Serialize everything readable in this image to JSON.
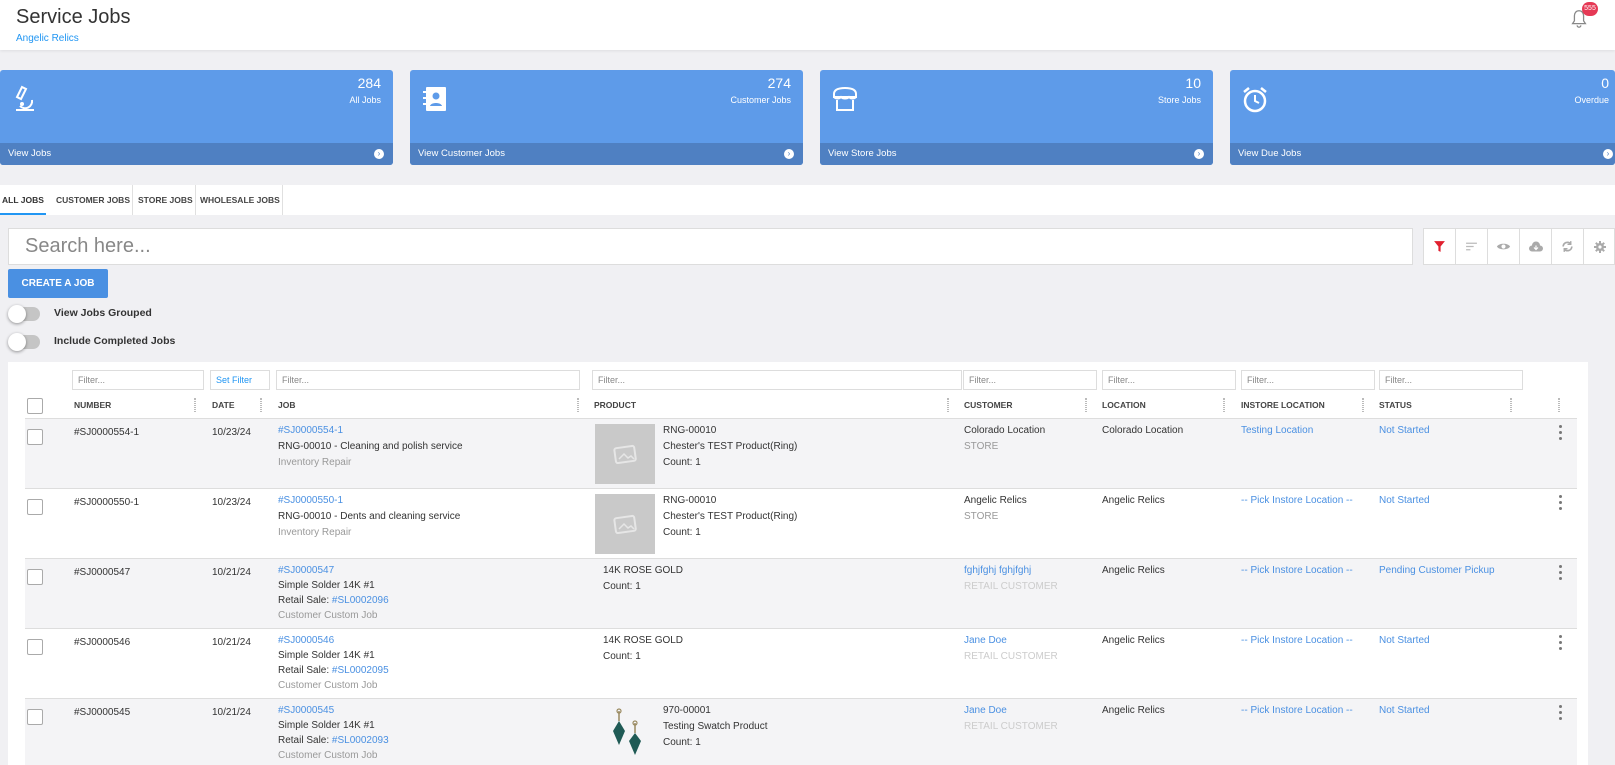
{
  "header": {
    "title": "Service Jobs",
    "subtitle": "Angelic Relics",
    "notification_count": "555"
  },
  "cards": [
    {
      "count": "284",
      "label": "All Jobs",
      "link": "View Jobs",
      "icon": "microscope-icon"
    },
    {
      "count": "274",
      "label": "Customer Jobs",
      "link": "View Customer Jobs",
      "icon": "contact-book-icon"
    },
    {
      "count": "10",
      "label": "Store Jobs",
      "link": "View Store Jobs",
      "icon": "store-icon"
    },
    {
      "count": "0",
      "label": "Overdue",
      "link": "View Due Jobs",
      "icon": "alarm-clock-icon"
    }
  ],
  "tabs": [
    "ALL JOBS",
    "CUSTOMER JOBS",
    "STORE JOBS",
    "WHOLESALE JOBS"
  ],
  "search": {
    "placeholder": "Search here..."
  },
  "create_button": "CREATE A JOB",
  "toggles": {
    "grouped": "View Jobs Grouped",
    "completed": "Include Completed Jobs"
  },
  "filters": {
    "number": "Filter...",
    "date": "Set Filter",
    "job": "Filter...",
    "product": "Filter...",
    "customer": "Filter...",
    "location": "Filter...",
    "instore": "Filter...",
    "status": "Filter..."
  },
  "columns": [
    "NUMBER",
    "DATE",
    "JOB",
    "PRODUCT",
    "CUSTOMER",
    "LOCATION",
    "INSTORE LOCATION",
    "STATUS"
  ],
  "rows": [
    {
      "number": "#SJ0000554-1",
      "date": "10/23/24",
      "job_link": "#SJ0000554-1",
      "job_desc": "RNG-00010 - Cleaning and polish service",
      "job_type": "Inventory Repair",
      "product_sku": "RNG-00010",
      "product_name": "Chester's TEST Product(Ring)",
      "product_count": "Count: 1",
      "customer": "Colorado Location",
      "customer_type": "STORE",
      "location": "Colorado Location",
      "instore": "Testing Location",
      "status": "Not Started"
    },
    {
      "number": "#SJ0000550-1",
      "date": "10/23/24",
      "job_link": "#SJ0000550-1",
      "job_desc": "RNG-00010 - Dents and cleaning service",
      "job_type": "Inventory Repair",
      "product_sku": "RNG-00010",
      "product_name": "Chester's TEST Product(Ring)",
      "product_count": "Count: 1",
      "customer": "Angelic Relics",
      "customer_type": "STORE",
      "location": "Angelic Relics",
      "instore": "-- Pick Instore Location --",
      "status": "Not Started"
    },
    {
      "number": "#SJ0000547",
      "date": "10/21/24",
      "job_link": "#SJ0000547",
      "job_desc": "Simple Solder 14K #1",
      "retail_label": "Retail Sale: ",
      "retail_link": "#SL0002096",
      "job_type": "Customer Custom Job",
      "product_name": "14K ROSE GOLD",
      "product_count": "Count: 1",
      "customer": "fghjfghj fghjfghj",
      "customer_type": "RETAIL CUSTOMER",
      "location": "Angelic Relics",
      "instore": "-- Pick Instore Location --",
      "status": "Pending Customer Pickup"
    },
    {
      "number": "#SJ0000546",
      "date": "10/21/24",
      "job_link": "#SJ0000546",
      "job_desc": "Simple Solder 14K #1",
      "retail_label": "Retail Sale: ",
      "retail_link": "#SL0002095",
      "job_type": "Customer Custom Job",
      "product_name": "14K ROSE GOLD",
      "product_count": "Count: 1",
      "customer": "Jane Doe",
      "customer_type": "RETAIL CUSTOMER",
      "location": "Angelic Relics",
      "instore": "-- Pick Instore Location --",
      "status": "Not Started"
    },
    {
      "number": "#SJ0000545",
      "date": "10/21/24",
      "job_link": "#SJ0000545",
      "job_desc": "Simple Solder 14K #1",
      "retail_label": "Retail Sale: ",
      "retail_link": "#SL0002093",
      "job_type": "Customer Custom Job",
      "product_sku": "970-00001",
      "product_name": "Testing Swatch Product",
      "product_count": "Count: 1",
      "customer": "Jane Doe",
      "customer_type": "RETAIL CUSTOMER",
      "location": "Angelic Relics",
      "instore": "-- Pick Instore Location --",
      "status": "Not Started"
    }
  ],
  "colors": {
    "accent": "#4a90e2",
    "card": "#5e9be9",
    "card_footer": "#4f80c2",
    "badge": "#e53955",
    "filter_active": "#e0202f"
  }
}
